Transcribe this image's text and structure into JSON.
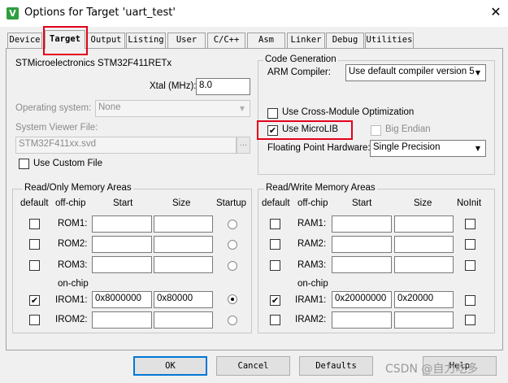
{
  "window": {
    "title": "Options for Target 'uart_test'",
    "icon_glyph": "V",
    "close_glyph": "✕"
  },
  "tabs": [
    "Device",
    "Target",
    "Output",
    "Listing",
    "User",
    "C/C++",
    "Asm",
    "Linker",
    "Debug",
    "Utilities"
  ],
  "active_tab": "Target",
  "device": {
    "name": "STMicroelectronics STM32F411RETx",
    "xtal_label": "Xtal (MHz):",
    "xtal_value": "8.0",
    "os_label": "Operating system:",
    "os_value": "None",
    "svd_label": "System Viewer File:",
    "svd_value": "STM32F411xx.svd",
    "browse_glyph": "...",
    "custom_file_label": "Use Custom File"
  },
  "codegen": {
    "title": "Code Generation",
    "compiler_label": "ARM Compiler:",
    "compiler_value": "Use default compiler version 5",
    "cross_module_label": "Use Cross-Module Optimization",
    "microlib_label": "Use MicroLIB",
    "big_endian_label": "Big Endian",
    "fpu_label": "Floating Point Hardware:",
    "fpu_value": "Single Precision"
  },
  "ro_memory": {
    "title": "Read/Only Memory Areas",
    "headers": {
      "default": "default",
      "chip": "off-chip",
      "start": "Start",
      "size": "Size",
      "last": "Startup"
    },
    "on_chip_label": "on-chip",
    "rows": [
      {
        "name": "ROM1:",
        "start": "",
        "size": ""
      },
      {
        "name": "ROM2:",
        "start": "",
        "size": ""
      },
      {
        "name": "ROM3:",
        "start": "",
        "size": ""
      },
      {
        "name": "IROM1:",
        "start": "0x8000000",
        "size": "0x80000"
      },
      {
        "name": "IROM2:",
        "start": "",
        "size": ""
      }
    ]
  },
  "rw_memory": {
    "title": "Read/Write Memory Areas",
    "headers": {
      "default": "default",
      "chip": "off-chip",
      "start": "Start",
      "size": "Size",
      "last": "NoInit"
    },
    "on_chip_label": "on-chip",
    "rows": [
      {
        "name": "RAM1:",
        "start": "",
        "size": ""
      },
      {
        "name": "RAM2:",
        "start": "",
        "size": ""
      },
      {
        "name": "RAM3:",
        "start": "",
        "size": ""
      },
      {
        "name": "IRAM1:",
        "start": "0x20000000",
        "size": "0x20000"
      },
      {
        "name": "IRAM2:",
        "start": "",
        "size": ""
      }
    ]
  },
  "check_glyph": "✔",
  "buttons": {
    "ok": "OK",
    "cancel": "Cancel",
    "defaults": "Defaults",
    "help": "Help"
  },
  "watermark": "CSDN @自力吃多",
  "colors": {
    "highlight": "#e3001b",
    "focus": "#0078d7",
    "face": "#f0f0f0"
  }
}
